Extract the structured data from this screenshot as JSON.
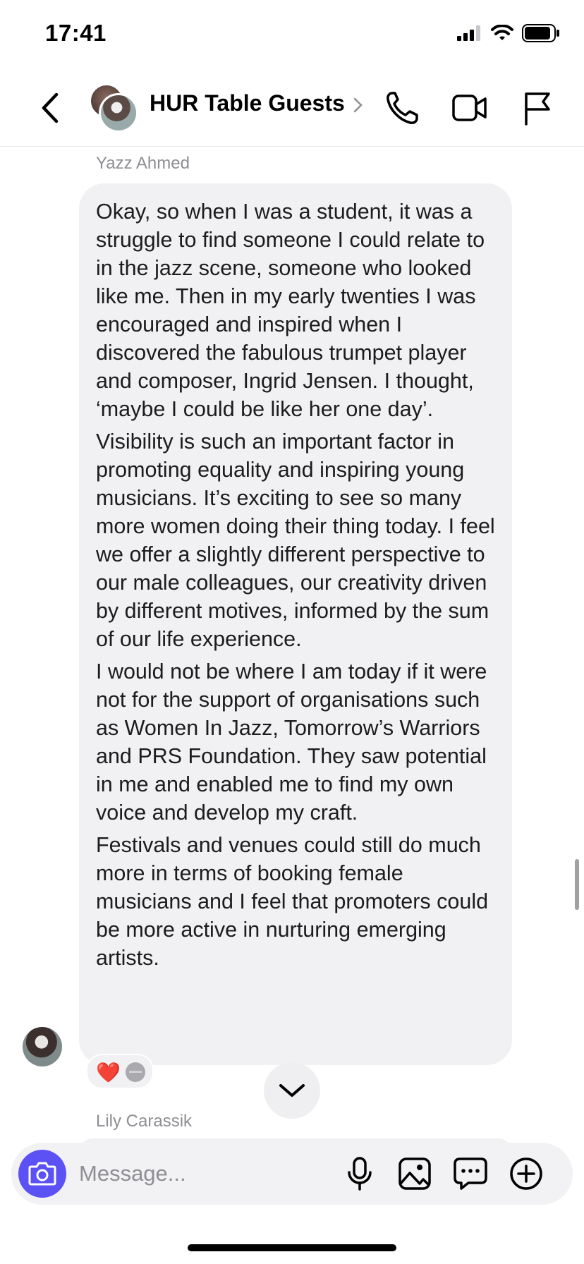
{
  "status_bar": {
    "time": "17:41",
    "battery_level": 0.9
  },
  "header": {
    "title": "HUR Table Guests"
  },
  "conversation": {
    "first_sender": "Yazz Ahmed",
    "message_paragraphs": [
      "Okay, so when I was a student, it was a struggle to find someone I could relate to in the jazz scene, someone who looked like me. Then in my early twenties I was encouraged and inspired when I discovered the fabulous trumpet player and composer, Ingrid Jensen. I thought, ‘maybe I could be like her one day’.",
      "Visibility is such an important factor in promoting equality and inspiring young musicians. It’s exciting to see so many more women doing their thing today. I feel we offer a slightly different perspective to our male colleagues, our creativity driven by different motives, informed by the sum of our life experience.",
      "I would not be where I am today if it were not for the support of organisations such as Women In Jazz, Tomorrow’s Warriors and PRS Foundation. They saw potential in me and enabled me to find my own voice and develop my craft.",
      "Festivals and venues could still do much more in terms of booking female musicians and I feel that promoters could be more active in nurturing emerging artists."
    ],
    "reaction": "❤️",
    "next_sender": "Lily Carassik"
  },
  "composer": {
    "placeholder": "Message..."
  },
  "icons": [
    "back-icon",
    "phone-icon",
    "video-icon",
    "flag-icon",
    "chevron-right-icon",
    "camera-icon",
    "microphone-icon",
    "image-icon",
    "sticker-icon",
    "add-icon",
    "chevron-down-icon"
  ]
}
